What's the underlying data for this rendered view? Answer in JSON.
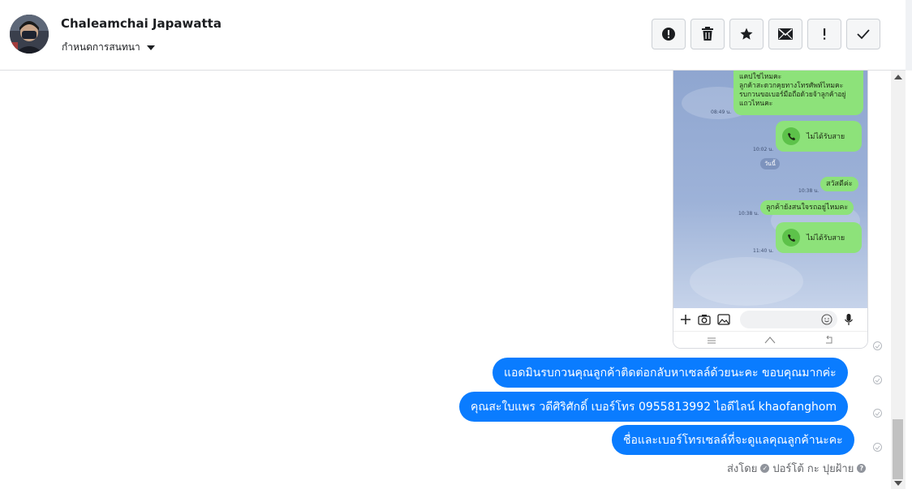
{
  "header": {
    "contact_name": "Chaleamchai Japawatta",
    "assign_label": "กำหนดการสนทนา"
  },
  "toolbar": {
    "buttons": [
      "alert-icon",
      "trash-icon",
      "star-icon",
      "envelope-icon",
      "exclamation-icon",
      "check-icon"
    ]
  },
  "attachment": {
    "bubble_top_text": "แคปใช่ไหมคะ\nลูกค้าสะดวกคุยทางโทรศัพท์ไหมคะ รบกวนขอเบอร์มือถือด้วยจ้าลูกค้าอยู่แถวไหนคะ",
    "time_1": "08:49 น.",
    "missed_call_1": "ไม่ได้รับสาย",
    "time_2": "10:02 น.",
    "day_label": "วันนี้",
    "time_3": "10:38 น.",
    "greeting": "สวัสดีค่ะ",
    "time_4": "10:38 น.",
    "question": "ลูกค้ายังสนใจรถอยู่ไหมคะ",
    "missed_call_2": "ไม่ได้รับสาย",
    "time_5": "11:40 น."
  },
  "messages": [
    {
      "text": "แอดมินรบกวนคุณลูกค้าติดต่อกลับหาเซลล์ด้วยนะคะ ขอบคุณมากค่ะ"
    },
    {
      "text": "คุณสะใบแพร วดีศิริศักดิ์ เบอร์โทร 0955813992  ไอดีไลน์  khaofanghom"
    },
    {
      "text": "ชื่อและเบอร์โทรเซลล์ที่จะดูแลคุณลูกค้านะคะ"
    }
  ],
  "sent_by": {
    "prefix": "ส่งโดย",
    "agent": "ปอร์โต้ กะ ปุยฝ้าย"
  },
  "colors": {
    "message_bubble": "#0a7cff",
    "line_bubble": "#8de27a"
  }
}
